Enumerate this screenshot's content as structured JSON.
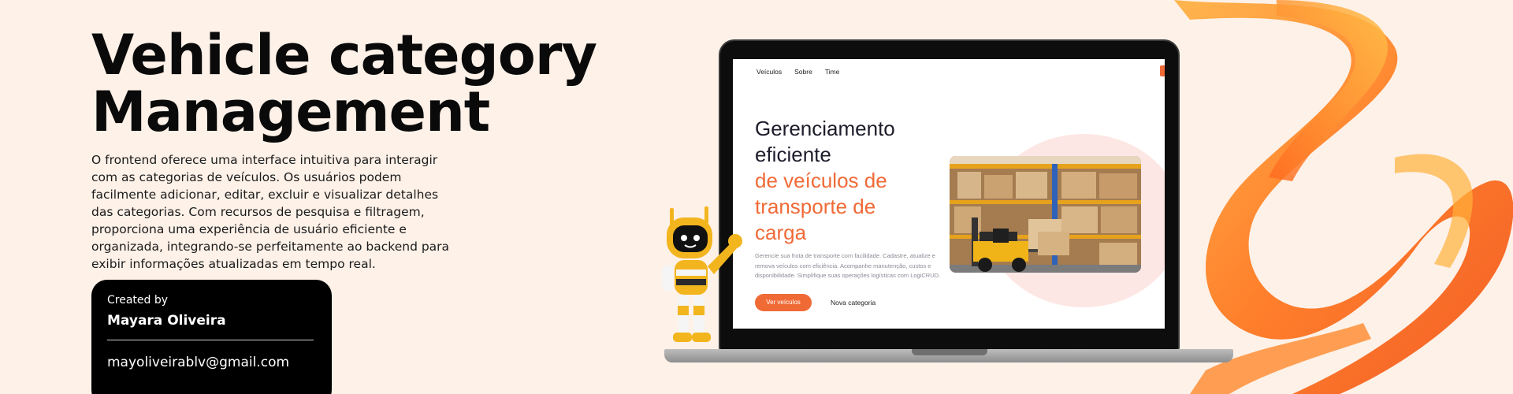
{
  "hero": {
    "title_line1": "Vehicle category",
    "title_line2": "Management",
    "description": "O frontend oferece uma interface intuitiva para interagir com as categorias de veículos. Os usuários podem facilmente adicionar, editar, excluir e visualizar detalhes das categorias. Com recursos de pesquisa e filtragem, proporciona uma experiência de usuário eficiente e organizada, integrando-se perfeitamente ao backend para exibir informações atualizadas em tempo real."
  },
  "credit": {
    "label": "Created by",
    "name": "Mayara Oliveira",
    "email": "mayoliveirablv@gmail.com"
  },
  "screen": {
    "nav": [
      "Veículos",
      "Sobre",
      "Time"
    ],
    "title_line1": "Gerenciamento",
    "title_line2": "eficiente",
    "title_line3": "de veículos de",
    "title_line4": "transporte de",
    "title_line5": "carga",
    "text": "Gerencie sua frota de transporte com facilidade. Cadastre, atualize e remova veículos com eficiência. Acompanhe manutenção, custos e disponibilidade. Simplifique suas operações logísticas com LogiCRUD.",
    "primary_button": "Ver veículos",
    "secondary_link": "Nova categoria"
  },
  "colors": {
    "background": "#fdf1e8",
    "accent": "#f06a36",
    "card": "#000000"
  }
}
